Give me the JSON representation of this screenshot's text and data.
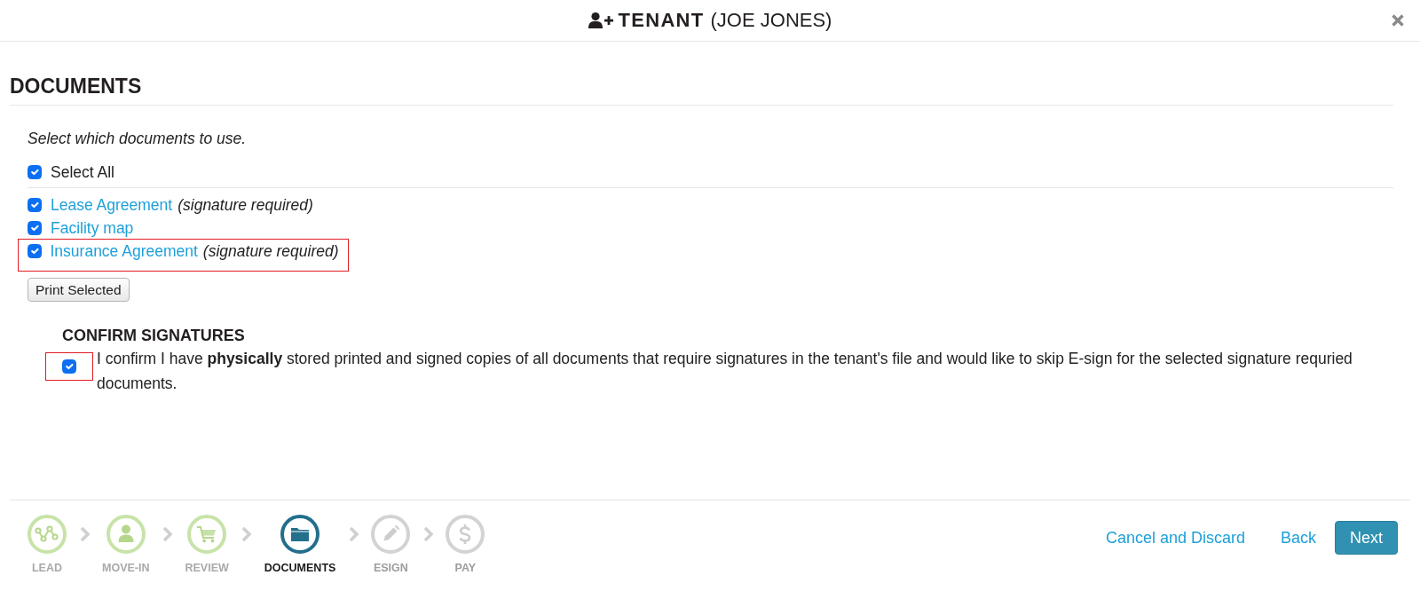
{
  "dialog": {
    "title": "TENANT",
    "tenant": "(JOE JONES)"
  },
  "section": {
    "title": "DOCUMENTS",
    "instruction": "Select which documents to use."
  },
  "select_all": {
    "label": "Select All",
    "checked": true
  },
  "documents": [
    {
      "name": "Lease Agreement",
      "note": "(signature required)",
      "checked": true,
      "highlighted": false
    },
    {
      "name": "Facility map",
      "checked": true,
      "highlighted": false
    },
    {
      "name": "Insurance Agreement",
      "note": "(signature required)",
      "checked": true,
      "highlighted": true
    }
  ],
  "print_button": "Print Selected",
  "confirm": {
    "title": "CONFIRM SIGNATURES",
    "checked": true,
    "highlighted": true,
    "text": "I confirm I have **physically** stored printed and signed copies of all documents that require signatures in the tenant's file and would like to skip E-sign for the selected signature requried documents."
  },
  "steps": [
    {
      "label": "LEAD",
      "completed": true,
      "selected": false
    },
    {
      "label": "MOVE-IN",
      "completed": true,
      "selected": false
    },
    {
      "label": "REVIEW",
      "completed": true,
      "selected": false
    },
    {
      "label": "DOCUMENTS",
      "completed": false,
      "selected": true
    },
    {
      "label": "ESIGN",
      "completed": false,
      "selected": false
    },
    {
      "label": "PAY",
      "completed": false,
      "selected": false
    }
  ],
  "actions": {
    "cancel": "Cancel and Discard",
    "back": "Back",
    "next": "Next"
  }
}
